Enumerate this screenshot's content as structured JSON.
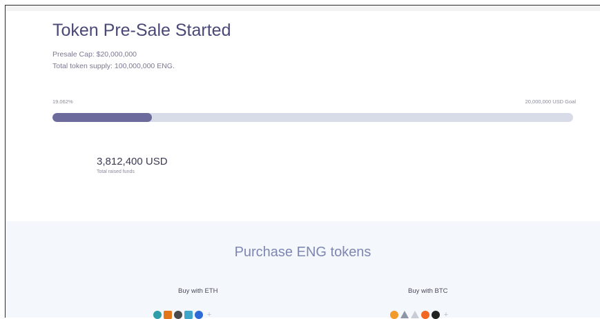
{
  "presale": {
    "title": "Token Pre-Sale Started",
    "cap": "Presale Cap: $20,000,000",
    "supply": "Total token supply: 100,000,000 ENG.",
    "percent_label": "19.062%",
    "goal_label": "20,000,000 USD Goal",
    "progress": 0.19062,
    "raised": "3,812,400 USD",
    "raised_caption": "Total raised funds"
  },
  "purchase": {
    "title": "Purchase ENG tokens",
    "eth_label": "Buy with ETH",
    "btc_label": "Buy with BTC",
    "eth_icons": [
      {
        "name": "wallet-icon-teal",
        "color": "#2f9ea8",
        "shape": "circle"
      },
      {
        "name": "metamask-fox-icon",
        "color": "#e2761b",
        "shape": "square"
      },
      {
        "name": "ledger-icon",
        "color": "#4a4a4a",
        "shape": "circle"
      },
      {
        "name": "myetherwallet-icon",
        "color": "#3fa6c9",
        "shape": "square"
      },
      {
        "name": "coinbase-icon",
        "color": "#2e6bd6",
        "shape": "circle"
      },
      {
        "name": "more-plus-icon",
        "color": "#b8bcc8",
        "shape": "plus"
      }
    ],
    "btc_icons": [
      {
        "name": "bitcoin-orange-icon",
        "color": "#f29a2b",
        "shape": "circle"
      },
      {
        "name": "ethereum-icon",
        "color": "#8d95a6",
        "shape": "tri"
      },
      {
        "name": "ethereum-light-icon",
        "color": "#c7ccd6",
        "shape": "tri"
      },
      {
        "name": "monero-icon",
        "color": "#f26822",
        "shape": "circle"
      },
      {
        "name": "bitcoin-dark-icon",
        "color": "#222222",
        "shape": "circle"
      },
      {
        "name": "more-plus-icon",
        "color": "#b8bcc8",
        "shape": "plus"
      }
    ]
  },
  "colors": {
    "accent": "#6d6a9c",
    "track": "#d8dbe8",
    "title": "#4a4876",
    "purchase_title": "#7e86b2",
    "section_bg": "#f4f7fb"
  }
}
